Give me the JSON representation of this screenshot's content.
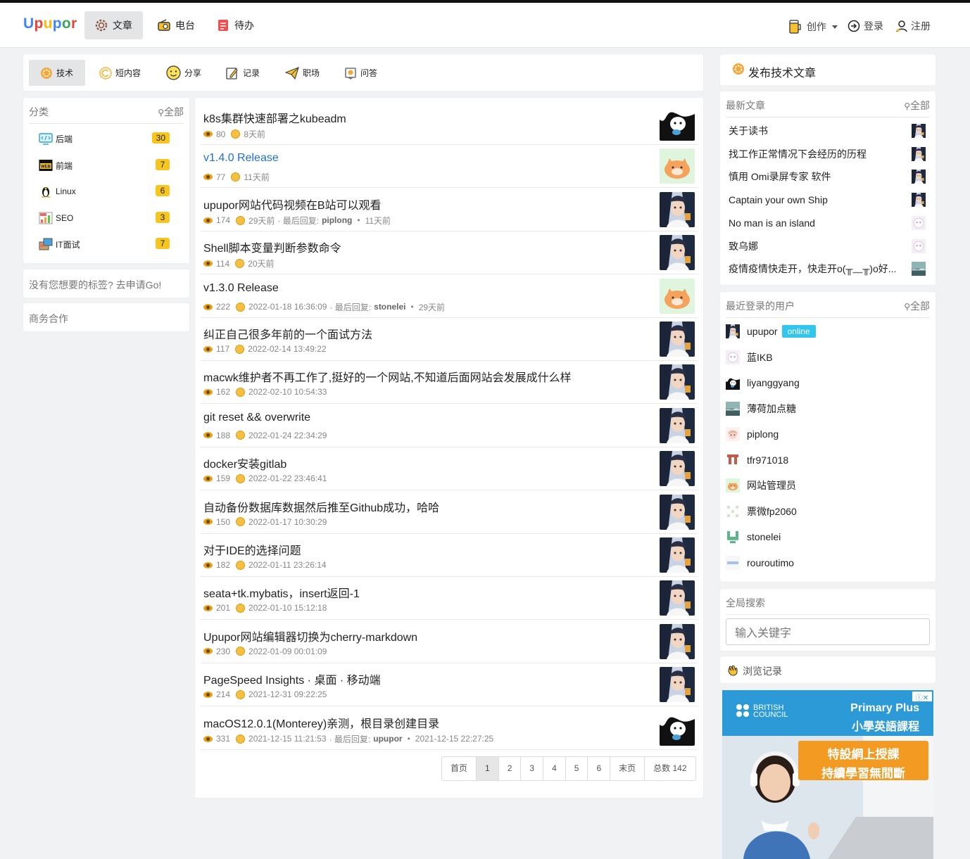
{
  "header": {
    "logo": "Upupor",
    "nav": [
      {
        "label": "文章",
        "icon": "gear-icon",
        "active": true
      },
      {
        "label": "电台",
        "icon": "radio-icon",
        "active": false
      },
      {
        "label": "待办",
        "icon": "todo-icon",
        "active": false
      }
    ],
    "create": "创作",
    "login": "登录",
    "register": "注册"
  },
  "categoryTabs": [
    {
      "label": "技术",
      "icon": "gear-icon",
      "active": true
    },
    {
      "label": "短内容",
      "icon": "refresh-icon",
      "active": false
    },
    {
      "label": "分享",
      "icon": "smile-icon",
      "active": false
    },
    {
      "label": "记录",
      "icon": "note-icon",
      "active": false
    },
    {
      "label": "职场",
      "icon": "paperplane-icon",
      "active": false
    },
    {
      "label": "问答",
      "icon": "question-icon",
      "active": false
    }
  ],
  "sidebar": {
    "title": "分类",
    "all": "全部",
    "items": [
      {
        "label": "后端",
        "count": "30",
        "icon": "backend-icon"
      },
      {
        "label": "前端",
        "count": "7",
        "icon": "web-icon"
      },
      {
        "label": "Linux",
        "count": "6",
        "icon": "linux-icon"
      },
      {
        "label": "SEO",
        "count": "3",
        "icon": "seo-icon"
      },
      {
        "label": "IT面试",
        "count": "7",
        "icon": "interview-icon"
      }
    ],
    "apply": "没有您想要的标签? 去申请Go!",
    "business": "商务合作"
  },
  "articles": [
    {
      "title": "k8s集群快速部署之kubeadm",
      "views": "80",
      "time": "8天前",
      "reply": "",
      "replyTime": "",
      "blue": false,
      "thumb": "cat"
    },
    {
      "title": "v1.4.0 Release",
      "views": "77",
      "time": "11天前",
      "reply": "",
      "replyTime": "",
      "blue": true,
      "thumb": "bun"
    },
    {
      "title": "upupor网站代码视频在B站可以观看",
      "views": "174",
      "time": "29天前",
      "reply": "piplong",
      "replyTime": "11天前",
      "blue": false,
      "thumb": "anime"
    },
    {
      "title": "Shell脚本变量判断参数命令",
      "views": "114",
      "time": "20天前",
      "reply": "",
      "replyTime": "",
      "blue": false,
      "thumb": "anime"
    },
    {
      "title": "v1.3.0 Release",
      "views": "222",
      "time": "2022-01-18 16:36:09",
      "reply": "stonelei",
      "replyTime": "29天前",
      "blue": false,
      "thumb": "bun"
    },
    {
      "title": "纠正自己很多年前的一个面试方法",
      "views": "117",
      "time": "2022-02-14 13:49:22",
      "reply": "",
      "replyTime": "",
      "blue": false,
      "thumb": "anime"
    },
    {
      "title": "macwk维护者不再工作了,挺好的一个网站,不知道后面网站会发展成什么样",
      "views": "162",
      "time": "2022-02-10 10:54:33",
      "reply": "",
      "replyTime": "",
      "blue": false,
      "thumb": "anime"
    },
    {
      "title": "git reset && overwrite",
      "views": "188",
      "time": "2022-01-24 22:34:29",
      "reply": "",
      "replyTime": "",
      "blue": false,
      "thumb": "anime"
    },
    {
      "title": "docker安装gitlab",
      "views": "159",
      "time": "2022-01-22 23:46:41",
      "reply": "",
      "replyTime": "",
      "blue": false,
      "thumb": "anime"
    },
    {
      "title": "自动备份数据库数据然后推至Github成功，哈哈",
      "views": "150",
      "time": "2022-01-17 10:30:29",
      "reply": "",
      "replyTime": "",
      "blue": false,
      "thumb": "anime"
    },
    {
      "title": "对于IDE的选择问题",
      "views": "182",
      "time": "2022-01-11 23:26:14",
      "reply": "",
      "replyTime": "",
      "blue": false,
      "thumb": "anime"
    },
    {
      "title": "seata+tk.mybatis，insert返回-1",
      "views": "201",
      "time": "2022-01-10 15:12:18",
      "reply": "",
      "replyTime": "",
      "blue": false,
      "thumb": "anime"
    },
    {
      "title": "Upupor网站编辑器切换为cherry-markdown",
      "views": "230",
      "time": "2022-01-09 00:01:09",
      "reply": "",
      "replyTime": "",
      "blue": false,
      "thumb": "anime"
    },
    {
      "title": "PageSpeed Insights · 桌面 · 移动端",
      "views": "214",
      "time": "2021-12-31 09:22:25",
      "reply": "",
      "replyTime": "",
      "blue": false,
      "thumb": "anime"
    },
    {
      "title": "macOS12.0.1(Monterey)亲测，根目录创建目录",
      "views": "331",
      "time": "2021-12-15 11:21:53",
      "reply": "upupor",
      "replyTime": "2021-12-15 22:27:25",
      "blue": false,
      "thumb": "cat"
    }
  ],
  "replyLabel": "· 最后回复:",
  "pager": [
    "首页",
    "1",
    "2",
    "3",
    "4",
    "5",
    "6",
    "末页",
    "总数 142"
  ],
  "right": {
    "publish": "发布技术文章",
    "latest": {
      "title": "最新文章",
      "all": "全部",
      "items": [
        {
          "title": "关于读书",
          "ava": "anime"
        },
        {
          "title": "找工作正常情况下会经历的历程",
          "ava": "anime"
        },
        {
          "title": "慎用 Omi录屏专家 软件",
          "ava": "anime"
        },
        {
          "title": "Captain your own Ship",
          "ava": "anime"
        },
        {
          "title": "No man is an island",
          "ava": "pink"
        },
        {
          "title": "致乌娜",
          "ava": "pink"
        },
        {
          "title": "疫情疫情快走开，快走开o(╥﹏╥)o好...",
          "ava": "sea"
        }
      ]
    },
    "users": {
      "title": "最近登录的用户",
      "all": "全部",
      "items": [
        {
          "name": "upupor",
          "online": "online",
          "ava": "anime"
        },
        {
          "name": "蓝IKB",
          "online": "",
          "ava": "pink"
        },
        {
          "name": "liyanggyang",
          "online": "",
          "ava": "cat"
        },
        {
          "name": "薄荷加点糖",
          "online": "",
          "ava": "sea"
        },
        {
          "name": "piplong",
          "online": "",
          "ava": "girl"
        },
        {
          "name": "tfr971018",
          "online": "",
          "ava": "pixel"
        },
        {
          "name": "网站管理员",
          "online": "",
          "ava": "bun"
        },
        {
          "name": "票微fp2060",
          "online": "",
          "ava": "pixel2"
        },
        {
          "name": "stonelei",
          "online": "",
          "ava": "pixel3"
        },
        {
          "name": "rouroutimo",
          "online": "",
          "ava": "bar"
        }
      ]
    },
    "search": {
      "title": "全局搜索",
      "placeholder": "输入关键字"
    },
    "history": "浏览记录"
  },
  "ad": {
    "brand": "BRITISH\nCOUNCIL",
    "line1": "Primary Plus",
    "line2": "小學英語課程",
    "promo1": "特設網上授課",
    "promo2": "持續學習無間斷"
  }
}
